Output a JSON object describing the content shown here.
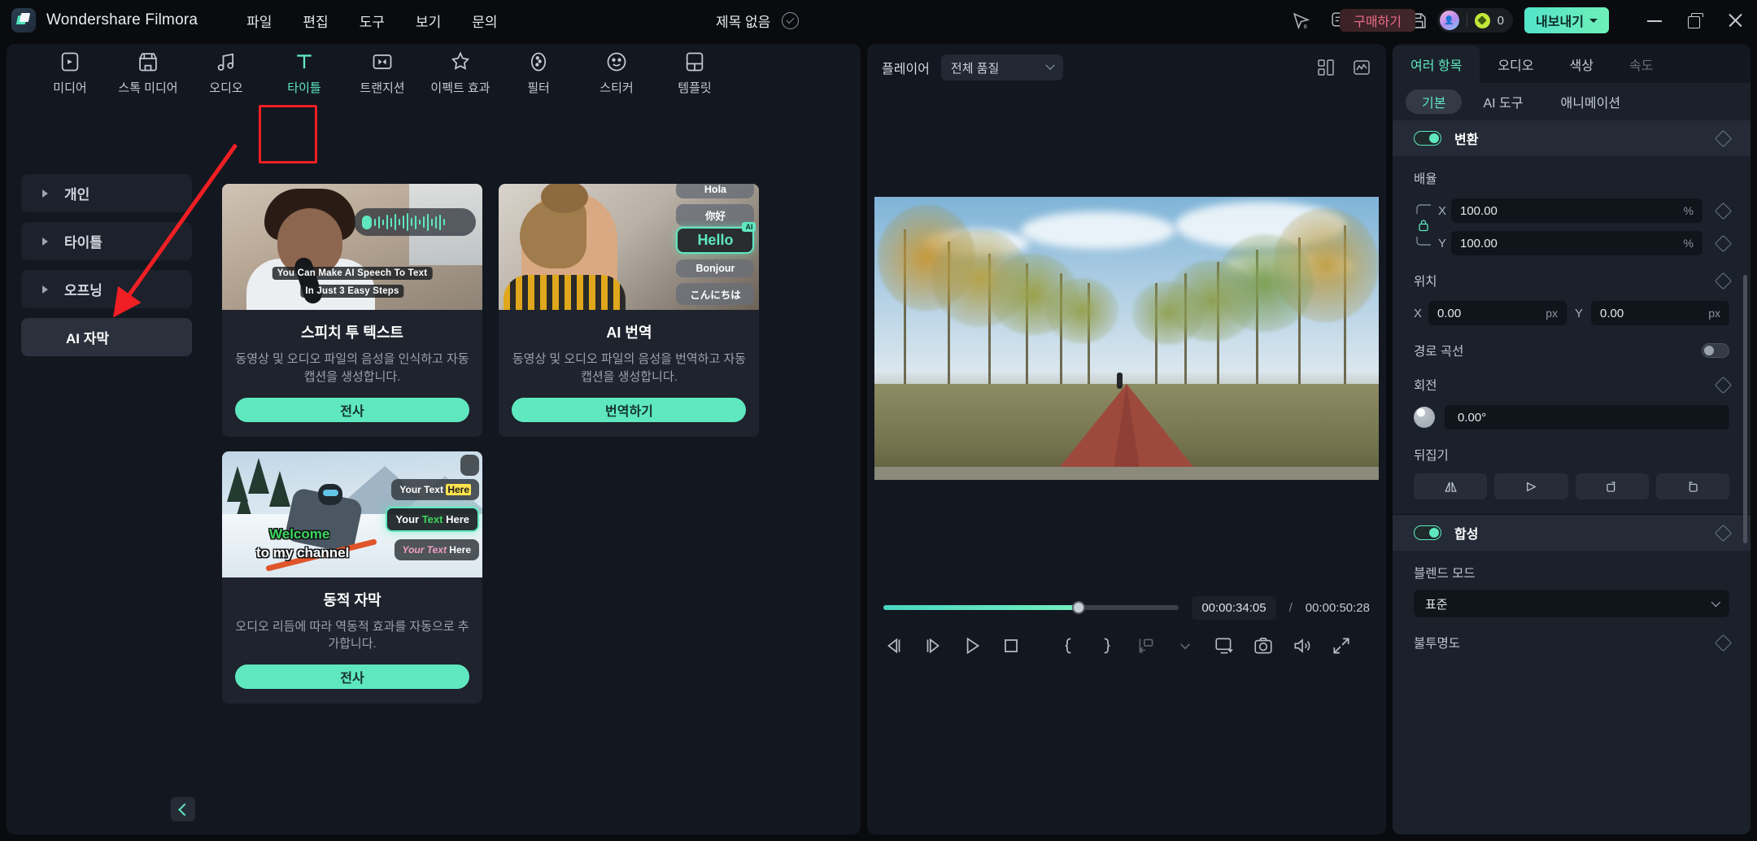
{
  "app": {
    "brand": "Wondershare Filmora",
    "menus": [
      "파일",
      "편집",
      "도구",
      "보기",
      "문의"
    ],
    "document_title": "제목 없음",
    "buy_label": "구매하기",
    "credits": "0",
    "export_label": "내보내기"
  },
  "category_tabs": [
    {
      "label": "미디어",
      "icon": "media-icon"
    },
    {
      "label": "스톡 미디어",
      "icon": "stock-media-icon"
    },
    {
      "label": "오디오",
      "icon": "audio-icon"
    },
    {
      "label": "타이틀",
      "icon": "title-icon",
      "active": true
    },
    {
      "label": "트랜지션",
      "icon": "transition-icon"
    },
    {
      "label": "이펙트 효과",
      "icon": "effects-icon"
    },
    {
      "label": "필터",
      "icon": "filter-icon"
    },
    {
      "label": "스티커",
      "icon": "sticker-icon"
    },
    {
      "label": "템플릿",
      "icon": "template-icon"
    }
  ],
  "sidebar": {
    "items": [
      {
        "label": "개인",
        "caret": true,
        "selected": false
      },
      {
        "label": "타이틀",
        "caret": true,
        "selected": false
      },
      {
        "label": "오프닝",
        "caret": true,
        "selected": false
      },
      {
        "label": "AI 자막",
        "caret": false,
        "selected": true
      }
    ]
  },
  "cards": [
    {
      "title": "스피치 투 텍스트",
      "desc": "동영상 및 오디오 파일의 음성을 인식하고 자동 캡션을 생성합니다.",
      "button": "전사",
      "thumb_caption_line1": "You Can Make AI Speech To Text",
      "thumb_caption_line2": "In Just  3 Easy Steps"
    },
    {
      "title": "AI 번역",
      "desc": "동영상 및 오디오 파일의 음성을 번역하고 자동 캡션을 생성합니다.",
      "button": "번역하기",
      "chips": [
        "Hola",
        "你好",
        "Hello",
        "Bonjour",
        "こんにちは"
      ],
      "badge": "AI"
    },
    {
      "title": "동적 자막",
      "desc": "오디오 리듬에 따라 역동적 효과를 자동으로 추가합니다.",
      "button": "전사",
      "overlay_line1": "Welcome",
      "overlay_line2": "to my channel",
      "chips": [
        "Your Text Here",
        "Your Text Here",
        "Your Text Here"
      ]
    }
  ],
  "player": {
    "label": "플레이어",
    "quality": "전체 품질",
    "current_time": "00:00:34:05",
    "separator": "/",
    "total_time": "00:00:50:28",
    "progress_percent": 66
  },
  "properties": {
    "tabs": [
      {
        "label": "여러 항목",
        "active": true
      },
      {
        "label": "오디오",
        "active": false
      },
      {
        "label": "색상",
        "active": false
      },
      {
        "label": "속도",
        "active": false,
        "faded": true
      }
    ],
    "sub_tabs": [
      {
        "label": "기본",
        "active": true
      },
      {
        "label": "AI 도구",
        "active": false
      },
      {
        "label": "애니메이션",
        "active": false
      }
    ],
    "transform": {
      "title": "변환",
      "enabled": true,
      "scale_label": "배율",
      "scale_x": "100.00",
      "scale_y": "100.00",
      "scale_unit": "%",
      "position_label": "위치",
      "position_x": "0.00",
      "position_y": "0.00",
      "position_unit": "px",
      "path_curve_label": "경로 곡선",
      "path_curve_enabled": false,
      "rotate_label": "회전",
      "rotate_value": "0.00°",
      "flip_label": "뒤집기",
      "axis_x": "X",
      "axis_y": "Y"
    },
    "compositing": {
      "title": "합성",
      "enabled": true,
      "blend_label": "블렌드 모드",
      "blend_value": "표준",
      "opacity_label": "불투명도"
    }
  },
  "colors": {
    "accent": "#5fe8c0",
    "panel_bg": "#131720",
    "window_bg": "#0a0b0e",
    "highlight_red": "#f01f24",
    "buy_text": "#ec6d88"
  }
}
